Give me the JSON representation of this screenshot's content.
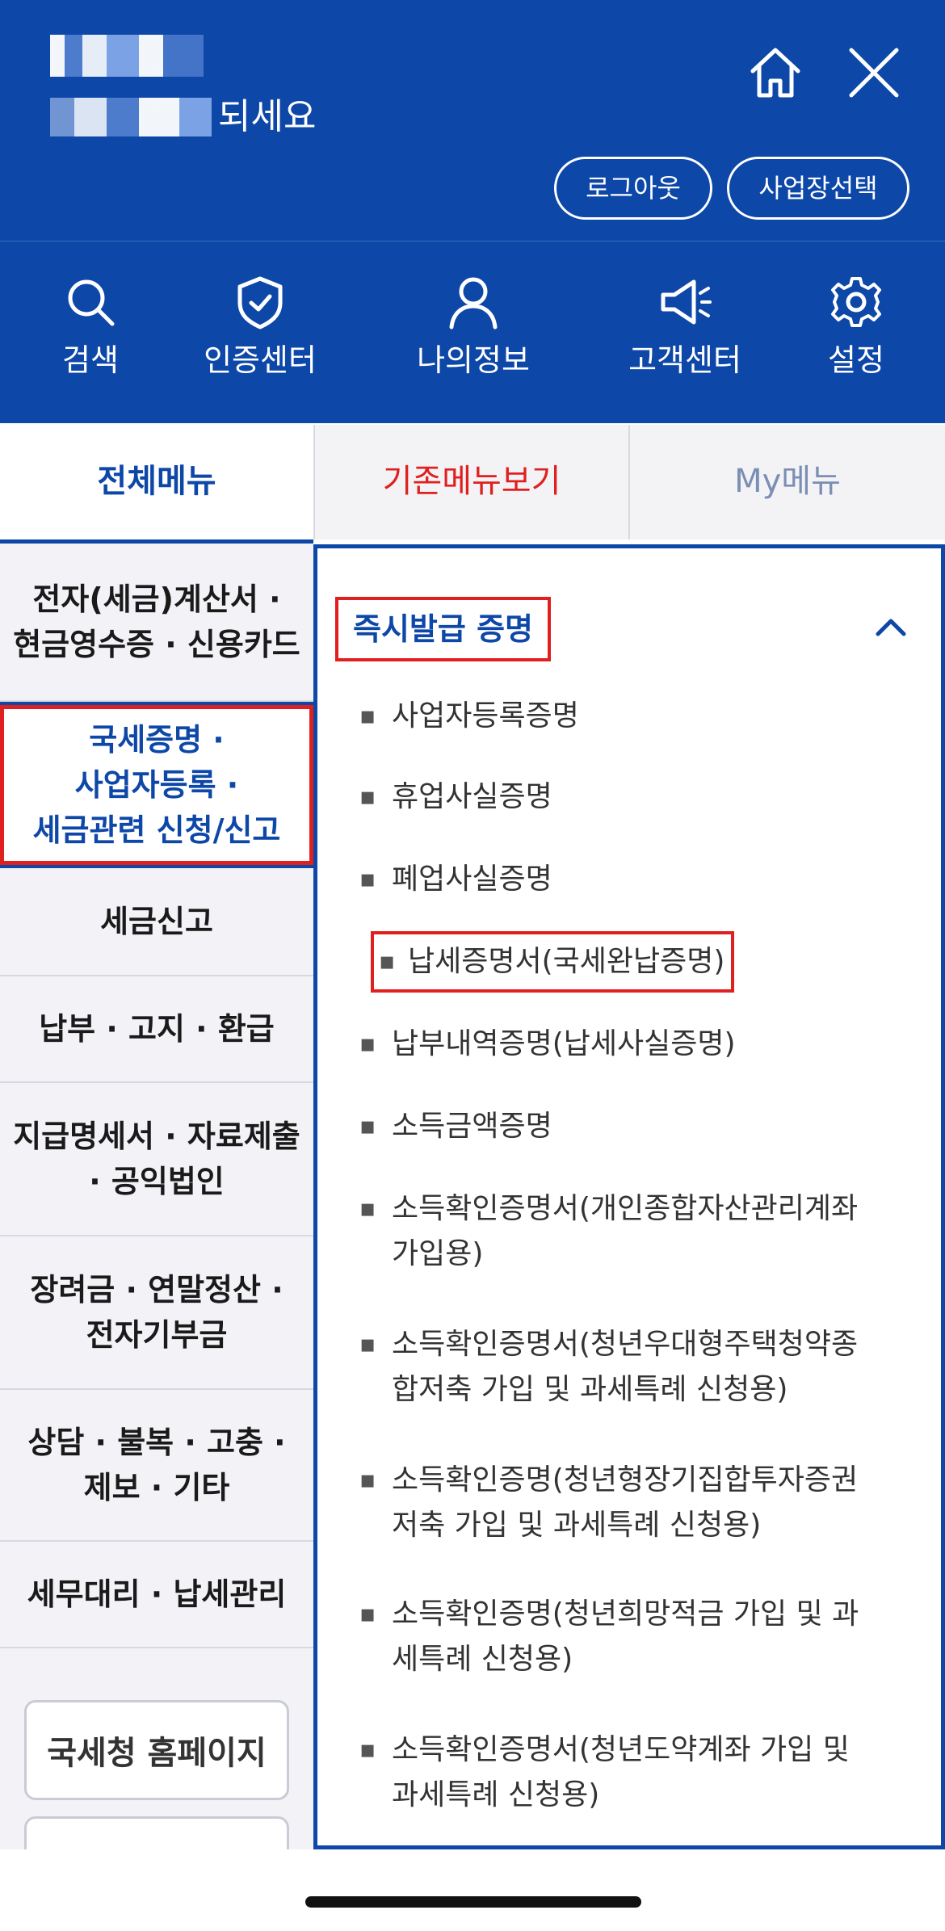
{
  "header": {
    "greeting_suffix": "되세요",
    "logout_label": "로그아웃",
    "select_business_label": "사업장선택"
  },
  "quick_menu": [
    {
      "label": "검색",
      "icon": "search-icon"
    },
    {
      "label": "인증센터",
      "icon": "shield-check-icon"
    },
    {
      "label": "나의정보",
      "icon": "user-icon"
    },
    {
      "label": "고객센터",
      "icon": "megaphone-icon"
    },
    {
      "label": "설정",
      "icon": "gear-icon"
    }
  ],
  "tabs": [
    {
      "label": "전체메뉴",
      "state": "selected",
      "color": "#0d47a8"
    },
    {
      "label": "기존메뉴보기",
      "color": "#e0201f"
    },
    {
      "label": "My메뉴",
      "color": "#7a8fb3"
    }
  ],
  "categories": [
    {
      "label": "전자(세금)계산서 ·\n현금영수증 · 신용카드"
    },
    {
      "label": "국세증명 ·\n사업자등록 ·\n세금관련 신청/신고",
      "state": "selected"
    },
    {
      "label": "세금신고"
    },
    {
      "label": "납부 · 고지 · 환급"
    },
    {
      "label": "지급명세서 · 자료제출\n· 공익법인"
    },
    {
      "label": "장려금 · 연말정산 ·\n전자기부금"
    },
    {
      "label": "상담 · 불복 · 고충 ·\n제보 · 기타"
    },
    {
      "label": "세무대리 · 납세관리"
    }
  ],
  "links": [
    {
      "label": "국세청 홈페이지"
    }
  ],
  "section": {
    "title": "즉시발급 증명",
    "bullet": "▪",
    "items": [
      {
        "label": "사업자등록증명"
      },
      {
        "label": "휴업사실증명"
      },
      {
        "label": "폐업사실증명"
      },
      {
        "label": "납세증명서(국세완납증명)",
        "highlighted": true
      },
      {
        "label": "납부내역증명(납세사실증명)"
      },
      {
        "label": "소득금액증명"
      },
      {
        "label": "소득확인증명서(개인종합자산관리계좌 가입용)"
      },
      {
        "label": "소득확인증명서(청년우대형주택청약종합저축 가입 및 과세특례 신청용)"
      },
      {
        "label": "소득확인증명(청년형장기집합투자증권저축 가입 및 과세특례 신청용)"
      },
      {
        "label": "소득확인증명(청년희망적금 가입 및 과세특례 신청용)"
      },
      {
        "label": "소득확인증명서(청년도약계좌 가입 및 과세특례 신청용)"
      }
    ]
  },
  "colors": {
    "brand_blue": "#0d47a8",
    "highlight_red": "#e0201f"
  }
}
